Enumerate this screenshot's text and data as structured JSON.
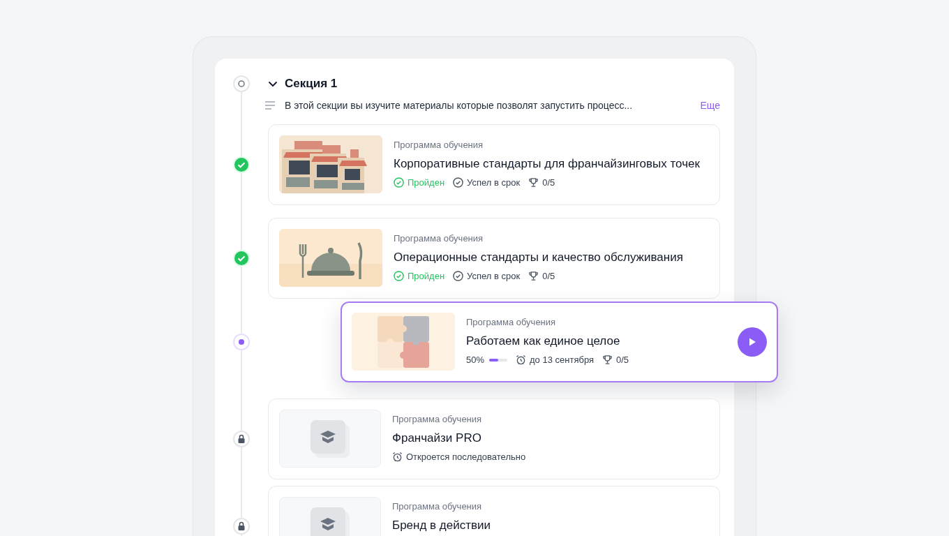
{
  "section": {
    "title": "Секция 1",
    "expanded": true,
    "description": "В этой секции вы изучите материалы которые позволят запустить процесс...",
    "more_link": "Еще"
  },
  "items": [
    {
      "kind": "done",
      "eyebrow": "Программа обучения",
      "title": "Корпоративные стандарты для франчайзинговых точек",
      "meta": [
        {
          "kind": "passed",
          "text": "Пройден"
        },
        {
          "kind": "on_time",
          "text": "Успел в срок"
        },
        {
          "kind": "trophy",
          "text": "0/5"
        }
      ]
    },
    {
      "kind": "done",
      "eyebrow": "Программа обучения",
      "title": "Операционные стандарты и качество обслуживания",
      "meta": [
        {
          "kind": "passed",
          "text": "Пройден"
        },
        {
          "kind": "on_time",
          "text": "Успел в срок"
        },
        {
          "kind": "trophy",
          "text": "0/5"
        }
      ]
    },
    {
      "kind": "active",
      "eyebrow": "Программа обучения",
      "title": "Работаем как единое целое",
      "meta": [
        {
          "kind": "progress",
          "text": "50%",
          "level": 0.5
        },
        {
          "kind": "deadline",
          "text": "до 13 сентября"
        },
        {
          "kind": "trophy",
          "text": "0/5"
        }
      ]
    },
    {
      "kind": "locked",
      "eyebrow": "Программа обучения",
      "title": "Франчайзи PRO",
      "meta": [
        {
          "kind": "opens",
          "text": "Откроется последовательно"
        }
      ]
    },
    {
      "kind": "locked",
      "eyebrow": "Программа обучения",
      "title": "Бренд в действии"
    }
  ]
}
